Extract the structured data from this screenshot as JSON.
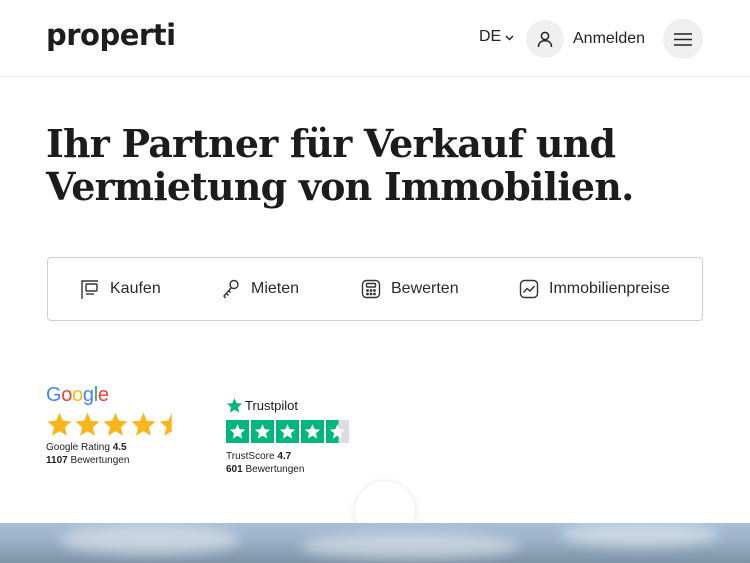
{
  "header": {
    "logo": "properti",
    "language": "DE",
    "login_label": "Anmelden"
  },
  "hero": {
    "headline_line1": "Ihr Partner für Verkauf und",
    "headline_line2": "Vermietung von Immobilien."
  },
  "tabs": [
    {
      "label": "Kaufen",
      "icon": "sign-icon"
    },
    {
      "label": "Mieten",
      "icon": "key-icon"
    },
    {
      "label": "Bewerten",
      "icon": "calculator-icon"
    },
    {
      "label": "Immobilienpreise",
      "icon": "chart-icon"
    }
  ],
  "google": {
    "logo": "Google",
    "rating_label": "Google Rating",
    "rating_value": "4.5",
    "reviews_count": "1107",
    "reviews_label": "Bewertungen",
    "star_color": "#f9b61c"
  },
  "trustpilot": {
    "logo": "Trustpilot",
    "score_label": "TrustScore",
    "score_value": "4.7",
    "reviews_count": "601",
    "reviews_label": "Bewertungen",
    "star_color": "#00b67a"
  }
}
